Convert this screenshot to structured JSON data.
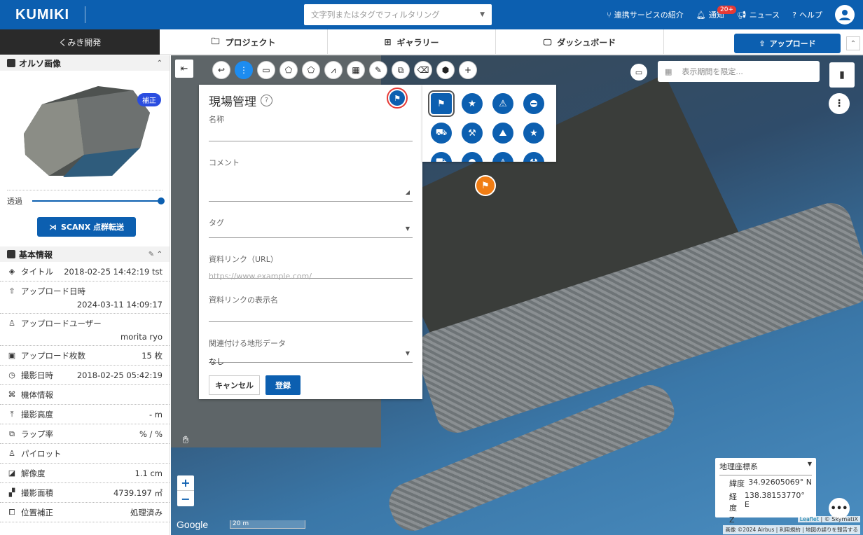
{
  "header": {
    "logo": "KUMIKI",
    "search_placeholder": "文字列またはタグでフィルタリング",
    "nav": {
      "integration": "連携サービスの紹介",
      "notifications": "通知",
      "notif_badge": "20+",
      "news": "ニュース",
      "help": "ヘルプ"
    }
  },
  "subnav": {
    "company": "くみき開発",
    "tabs": [
      {
        "label": "プロジェクト",
        "icon": "folder-icon"
      },
      {
        "label": "ギャラリー",
        "icon": "grid-icon"
      },
      {
        "label": "ダッシュボード",
        "icon": "monitor-icon"
      }
    ],
    "upload_label": "アップロード"
  },
  "sidebar": {
    "ortho_title": "オルソ画像",
    "hosei_badge": "補正",
    "opacity_label": "透過",
    "opacity_value": 1.0,
    "scanx_label": "SCANX 点群転送",
    "basic_info_title": "基本情報",
    "rows": [
      {
        "label": "タイトル",
        "value": "2018-02-25 14:42:19 tst"
      },
      {
        "label": "アップロード日時",
        "value": "2024-03-11 14:09:17"
      },
      {
        "label": "アップロードユーザー",
        "value": "morita ryo"
      },
      {
        "label": "アップロード枚数",
        "value": "15 枚"
      },
      {
        "label": "撮影日時",
        "value": "2018-02-25 05:42:19"
      },
      {
        "label": "機体情報",
        "value": ""
      },
      {
        "label": "撮影高度",
        "value": "- m"
      },
      {
        "label": "ラップ率",
        "value": "% / %"
      },
      {
        "label": "パイロット",
        "value": ""
      },
      {
        "label": "解像度",
        "value": "1.1 cm"
      },
      {
        "label": "撮影面積",
        "value": "4739.197 ㎡"
      },
      {
        "label": "位置補正",
        "value": "処理済み"
      }
    ]
  },
  "map": {
    "period_placeholder": "表示期間を限定...",
    "google": "Google",
    "scale": "20 m",
    "attribution_1_link": "Leaflet",
    "attribution_1_rest": "| © SkymatiX",
    "attribution_2": "画像 ©2024 Airbus | 利用規約 | 地図の誤りを報告する",
    "coords": {
      "system": "地理座標系",
      "lat_label": "緯度",
      "lat": "34.92605069° N",
      "lng_label": "経度",
      "lng": "138.38153770° E",
      "z_label": "Z",
      "z": "- m"
    }
  },
  "form": {
    "title": "現場管理",
    "name_label": "名称",
    "comment_label": "コメント",
    "tag_label": "タグ",
    "url_label": "資料リンク（URL）",
    "url_placeholder": "https://www.example.com/",
    "display_name_label": "資料リンクの表示名",
    "terrain_label": "関連付ける地形データ",
    "terrain_value": "なし",
    "cancel": "キャンセル",
    "register": "登録"
  },
  "colors": {
    "brand": "#0c5fb0",
    "marker_orange": "#f07d14",
    "highlight_red": "#e53935"
  }
}
